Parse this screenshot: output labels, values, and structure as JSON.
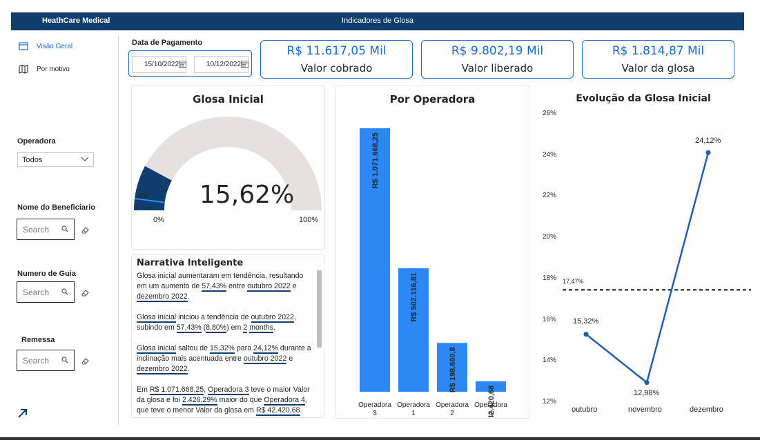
{
  "header": {
    "brand": "HeathCare Medical",
    "title": "Indicadores de Glosa"
  },
  "nav": {
    "items": [
      {
        "label": "Visão Geral",
        "active": true,
        "icon": "overview-icon"
      },
      {
        "label": "Por motivo",
        "active": false,
        "icon": "map-icon"
      }
    ],
    "back_icon": "arrow-up-right-icon"
  },
  "filters": {
    "operadora": {
      "label": "Operadora",
      "selected": "Todos"
    },
    "beneficiario": {
      "label": "Nome do Beneficiario",
      "placeholder": "Search"
    },
    "guia": {
      "label": "Numero de Guia",
      "placeholder": "Search"
    },
    "remessa": {
      "label": "Remessa",
      "placeholder": "Search"
    }
  },
  "date_slicer": {
    "label": "Data de Pagamento",
    "start": "15/10/2022",
    "end": "10/12/2022"
  },
  "kpis": [
    {
      "value": "R$ 11.617,05 Mil",
      "label": "Valor cobrado"
    },
    {
      "value": "R$ 9.802,19 Mil",
      "label": "Valor liberado"
    },
    {
      "value": "R$ 1.814,87 Mil",
      "label": "Valor da glosa"
    }
  ],
  "colors": {
    "accent": "#1b6ac9",
    "navy": "#0f3d6e",
    "bar": "#2b88f5",
    "gauge_track": "#e6e1de",
    "line": "#1f5fad"
  },
  "chart_data": [
    {
      "type": "gauge",
      "title": "Glosa Inicial",
      "value": 15.62,
      "value_label": "15,62%",
      "min": 0,
      "min_label": "0%",
      "max": 100,
      "max_label": "100%",
      "target": 4,
      "target_label": "4%"
    },
    {
      "type": "bar",
      "title": "Por Operadora",
      "categories": [
        "Operadora 3",
        "Operadora 1",
        "Operadora 2",
        "Operadora 4"
      ],
      "values": [
        1071668.25,
        502116.81,
        198660.8,
        42420.68
      ],
      "data_labels": [
        "R$ 1.071.668,25",
        "R$ 502.116,81",
        "R$ 198.660,8",
        "R$ 42.420,68"
      ]
    },
    {
      "type": "line",
      "title": "Evolução da Glosa Inicial",
      "categories": [
        "outubro",
        "novembro",
        "dezembro"
      ],
      "values": [
        15.32,
        12.98,
        24.12
      ],
      "data_labels": [
        "15,32%",
        "12,98%",
        "24,12%"
      ],
      "y_ticks": [
        "12%",
        "14%",
        "16%",
        "18%",
        "20%",
        "22%",
        "24%",
        "26%"
      ],
      "ylim": [
        12,
        26
      ],
      "average": 17.47,
      "average_label": "17,47%"
    }
  ],
  "narrative": {
    "title": "Narrativa Inteligente",
    "p1": {
      "t1": "Glosa inicial aumentaram em tendência, resultando em um aumento de ",
      "v1": "57,43%",
      "t2": " entre ",
      "v2": "outubro 2022",
      "t3": " e ",
      "v3": "dezembro 2022",
      "t4": "."
    },
    "p2": {
      "v1": "Glosa inicial",
      "t1": " iniciou a tendência de ",
      "v2": "outubro 2022",
      "t2": ", subindo em ",
      "v3": "57,43%",
      "t3": " (",
      "v4": "8,80%",
      "t4": ") em ",
      "v5": "2",
      "t5": " ",
      "v6": "months",
      "t6": "."
    },
    "p3": {
      "v1": "Glosa inicial",
      "t1": " saltou de ",
      "v2": "15,32%",
      "t2": " para ",
      "v3": "24,12%",
      "t3": " durante a inclinação mais acentuada entre ",
      "v4": "outubro 2022",
      "t4": " e ",
      "v5": "dezembro 2022",
      "t5": "."
    },
    "p4": {
      "t1": "Em ",
      "v1": "R$ 1.071.668,25",
      "t2": ", ",
      "v2": "Operadora 3",
      "t3": " teve o maior Valor da glosa e foi ",
      "v3": "2.426,29%",
      "t4": " maior do que ",
      "v4": "Operadora 4",
      "t5": ", que teve o menor Valor da glosa em ",
      "v5": "R$ 42.420,68",
      "t6": "."
    }
  }
}
